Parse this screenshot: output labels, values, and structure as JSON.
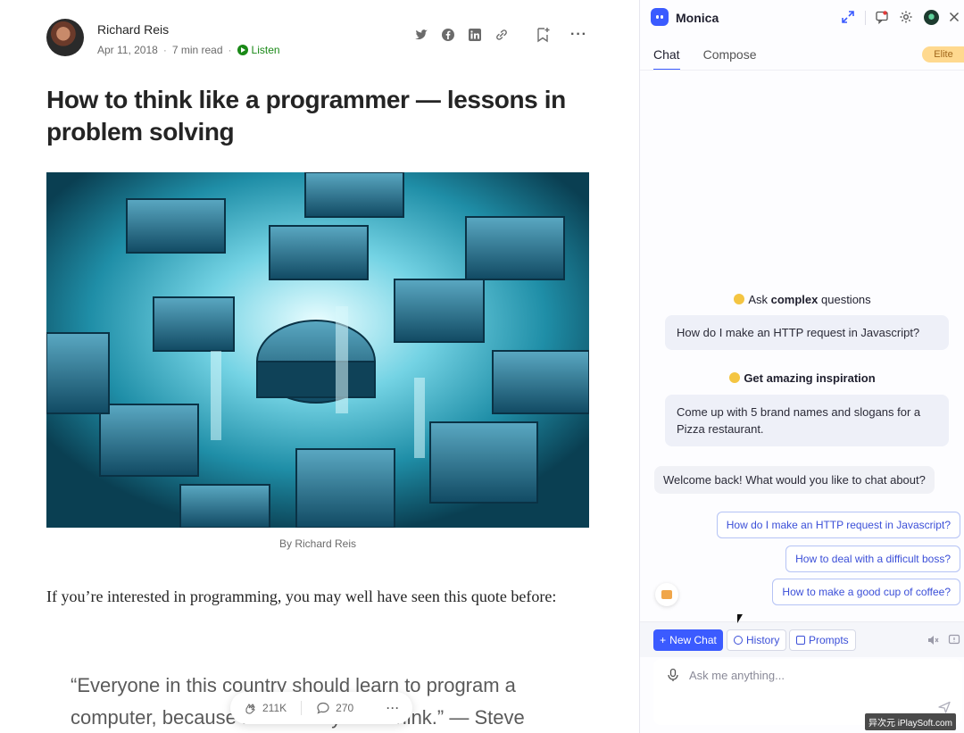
{
  "article": {
    "author": "Richard Reis",
    "date": "Apr 11, 2018",
    "read_time": "7 min read",
    "listen": "Listen",
    "title": "How to think like a programmer — lessons in problem solving",
    "caption": "By Richard Reis",
    "body": "If you’re interested in programming, you may well have seen this quote before:",
    "quote": "“Everyone in this country should learn to program a computer, because it teaches you to think.” — Steve",
    "claps": "211K",
    "responses": "270"
  },
  "panel": {
    "app_name": "Monica",
    "tabs": [
      "Chat",
      "Compose"
    ],
    "plan_badge": "Elite",
    "sections": [
      {
        "prefix": "Ask ",
        "bold": "complex",
        "suffix": " questions",
        "example": "How do I make an HTTP request in Javascript?"
      },
      {
        "prefix": "",
        "bold": "Get amazing inspiration",
        "suffix": "",
        "example": "Come up with 5 brand names and slogans for a Pizza restaurant."
      }
    ],
    "welcome": "Welcome back! What would you like to chat about?",
    "suggestions": [
      "How do I make an HTTP request in Javascript?",
      "How to deal with a difficult boss?",
      "How to make a good cup of coffee?"
    ],
    "toolbar": {
      "new_chat": "New Chat",
      "history": "History",
      "prompts": "Prompts"
    },
    "input_placeholder": "Ask me anything...",
    "watermark": "异次元 iPlaySoft.com"
  },
  "colors": {
    "accent": "#3b5bff",
    "listen_green": "#1a8917",
    "badge": "#ffd98f"
  }
}
